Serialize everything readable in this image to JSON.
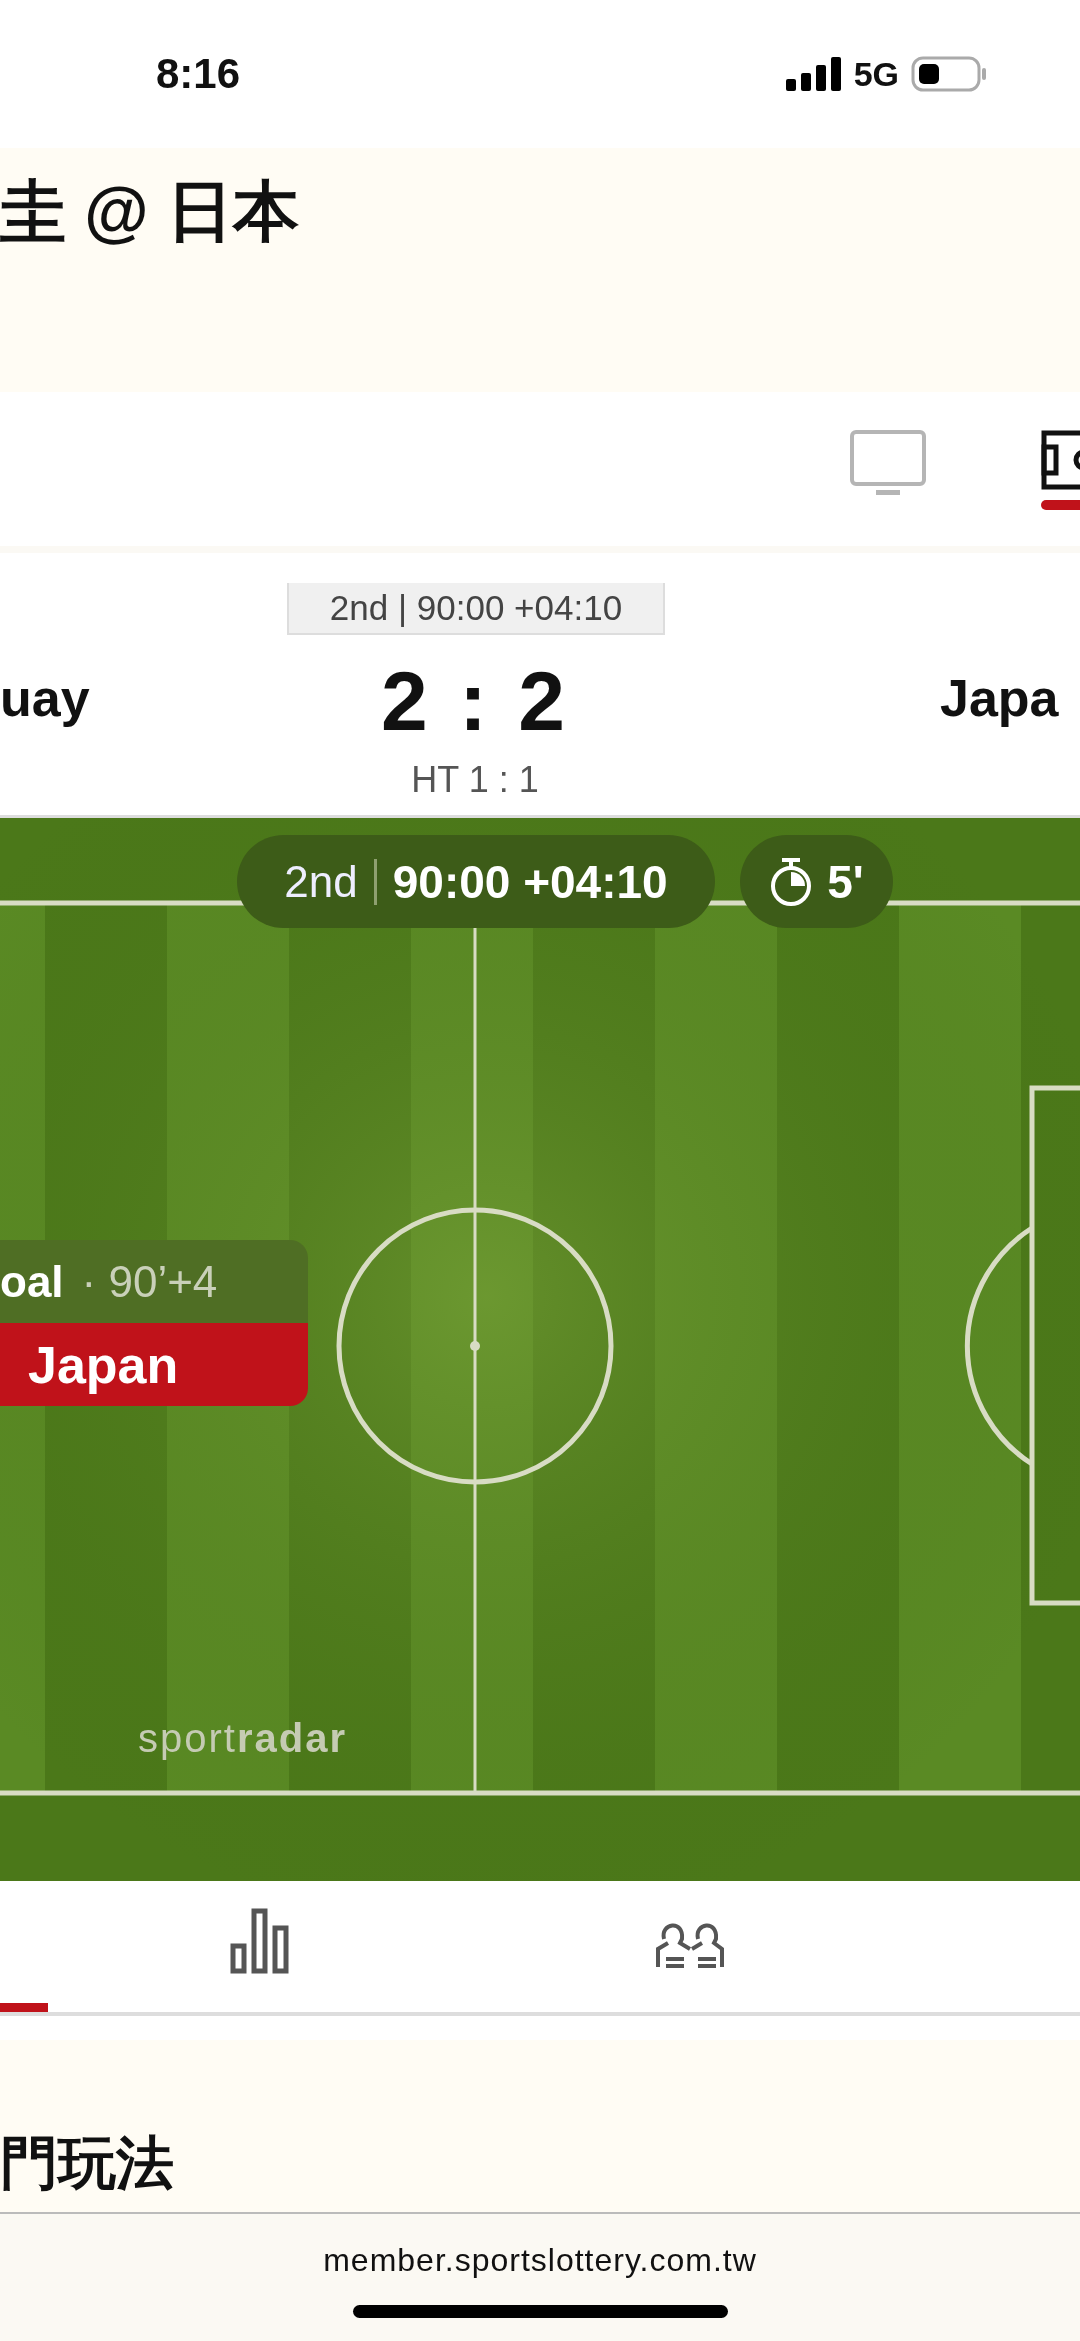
{
  "status_bar": {
    "time": "8:16",
    "network": "5G"
  },
  "title": "圭 @ 日本",
  "view_tabs": [
    {
      "kind": "tv",
      "selected": false
    },
    {
      "kind": "pitch",
      "selected": true
    }
  ],
  "scoreboard": {
    "period_clock": "2nd | 90:00 +04:10",
    "home_team": "uay",
    "score": "2 : 2",
    "away_team": "Japa",
    "halftime": "HT 1 : 1"
  },
  "pitch": {
    "period": "2nd",
    "clock": "90:00 +04:10",
    "countdown": "5'",
    "event": {
      "label": "oal",
      "detail": "· 90’+4",
      "team": "Japan"
    },
    "logo": "sport**radar**"
  },
  "stat_tabs": [
    {
      "kind": "hidden",
      "selected": true
    },
    {
      "kind": "stats",
      "selected": false
    },
    {
      "kind": "lineups",
      "selected": false
    }
  ],
  "section_title": "門玩法",
  "browser": {
    "url": "member.sportslottery.com.tw"
  }
}
